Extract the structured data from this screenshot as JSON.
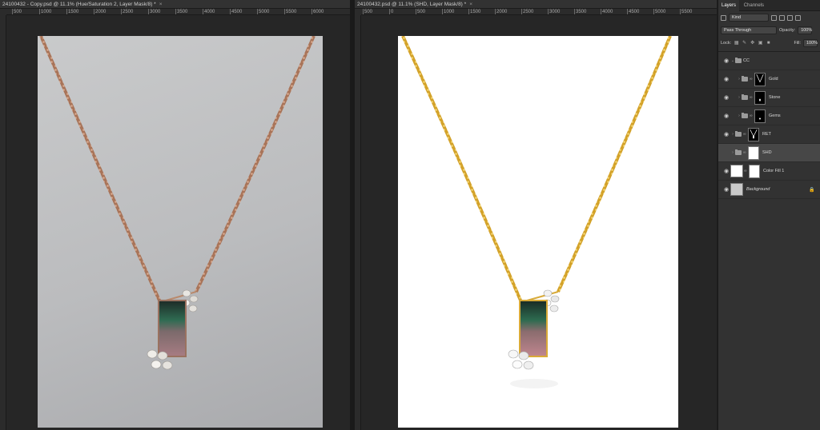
{
  "left_doc": {
    "tab_title": "24100432 - Copy.psd @ 11.1% (Hue/Saturation 2, Layer Mask/8) *",
    "close": "×",
    "ruler_ticks": [
      "500",
      "1000",
      "1500",
      "2000",
      "2500",
      "3000",
      "3500",
      "4000",
      "4500",
      "5000",
      "5500",
      "6000"
    ]
  },
  "right_doc": {
    "tab_title": "24100432.psd @ 11.1% (SHD, Layer Mask/8) *",
    "close": "×",
    "ruler_ticks": [
      "500",
      "0",
      "500",
      "1000",
      "1500",
      "2000",
      "2500",
      "3000",
      "3500",
      "4000",
      "4500",
      "5000",
      "5500"
    ]
  },
  "panel": {
    "tabs": [
      "Layers",
      "Channels"
    ],
    "kind_label": "Kind",
    "blend_mode": "Pass Through",
    "opacity_label": "Opacity:",
    "opacity_value": "100%",
    "lock_label": "Lock:",
    "fill_label": "Fill:",
    "fill_value": "100%",
    "layers": [
      {
        "name": "CC",
        "type": "group-open"
      },
      {
        "name": "Gold",
        "type": "group-masked"
      },
      {
        "name": "Stone",
        "type": "group-masked"
      },
      {
        "name": "Gems",
        "type": "group-masked"
      },
      {
        "name": "RET",
        "type": "group-masked"
      },
      {
        "name": "SHD",
        "type": "group-masked",
        "selected": true
      },
      {
        "name": "Color Fill 1",
        "type": "fill"
      },
      {
        "name": "Background",
        "type": "background",
        "locked": true
      }
    ]
  },
  "colors": {
    "rose_gold_chain": "#b6836a",
    "yellow_gold_chain": "#e1b43a",
    "panel_bg": "#323232",
    "selected_layer": "#474747"
  },
  "icons": [
    "eye-icon",
    "folder-icon",
    "chevron-icon",
    "link-icon",
    "lock-icon",
    "filter-icon",
    "close-icon"
  ]
}
